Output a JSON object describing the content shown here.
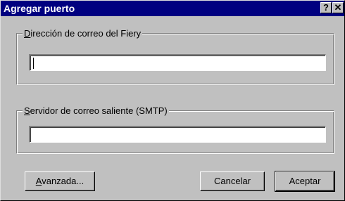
{
  "window": {
    "title": "Agregar puerto",
    "help_label": "?",
    "close_label": "✕"
  },
  "email_group": {
    "label_first": "D",
    "label_rest": "irección de correo del Fiery",
    "value": ""
  },
  "smtp_group": {
    "label_first": "S",
    "label_rest": "ervidor de correo saliente (SMTP)",
    "value": ""
  },
  "buttons": {
    "advanced_first": "A",
    "advanced_rest": "vanzada...",
    "cancel": "Cancelar",
    "accept": "Aceptar"
  }
}
